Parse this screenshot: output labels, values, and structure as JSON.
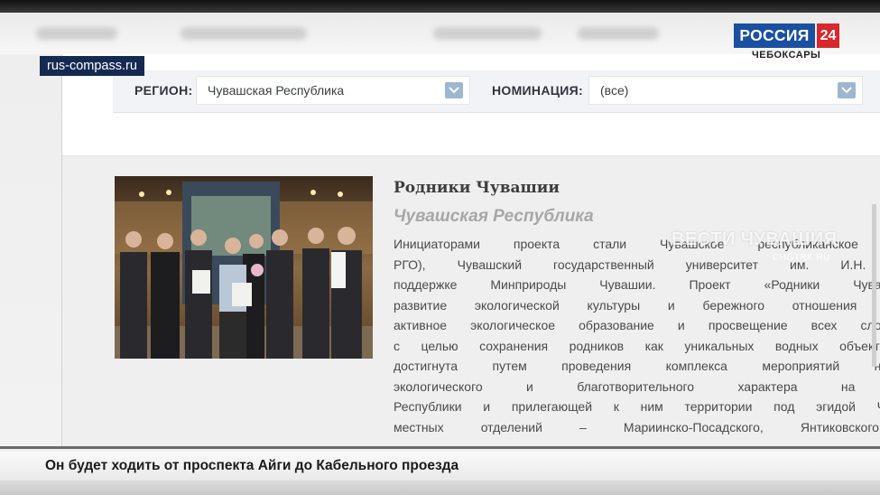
{
  "source_tag": "rus-compass.ru",
  "channel": {
    "name": "РОССИЯ",
    "number": "24",
    "city": "ЧЕБОКСАРЫ",
    "watermark": "ВЕСТИ ЧУВАШИЯ",
    "watermark_sub": "CHGTRK.RU",
    "brand_blue": "#1a4fa1",
    "brand_red": "#d6282d"
  },
  "filters": {
    "region_label": "РЕГИОН:",
    "region_value": "Чувашская Республика",
    "nomination_label": "НОМИНАЦИЯ:",
    "nomination_value": "(все)",
    "arrow_icon": "chevron-down-icon"
  },
  "card": {
    "title": "Родники Чувашии",
    "region": "Чувашская Республика",
    "lines": [
      "Инициаторами проекта стали Чувашское республиканское отделение",
      "РГО), Чувашский государственный университет им. И.Н. Ульянова",
      "поддержке Минприроды Чувашии. Проект «Родники Чувашии» н",
      "развитие экологической культуры и бережного отношения к родни",
      "активное экологическое образование и просвещение всех слоев насел",
      "с целью сохранения родников как уникальных водных объектов. Поста",
      "достигнута путем проведения комплекса мероприятий научно-просв",
      "экологического и благотворительного характера на родниках",
      "Республики и прилегающей к ним территории под эгидой ЧувРО РГ",
      "местных отделений – Мариинско-Посадского, Янтиковского, Шуме"
    ]
  },
  "ticker": {
    "text": "Он будет ходить от проспекта Айги до Кабельного проезда"
  }
}
